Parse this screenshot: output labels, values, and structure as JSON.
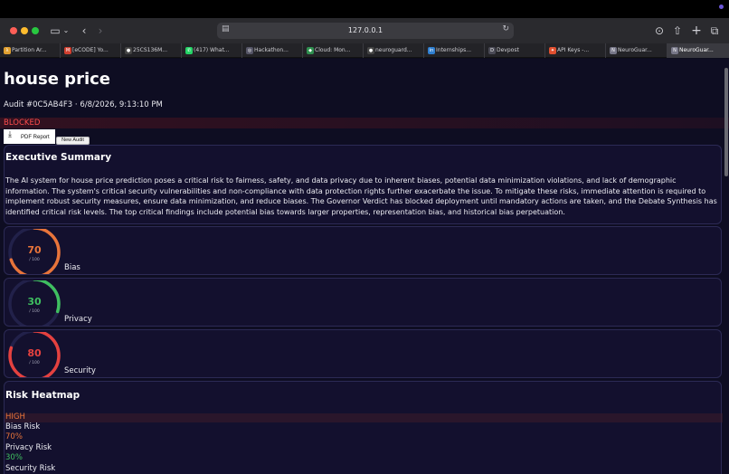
{
  "browser": {
    "url": "127.0.0.1",
    "tabs": [
      {
        "label": "Partition Ar...",
        "icon": "lambda-icon",
        "color": "#e0a030"
      },
      {
        "label": "[eCODE] Yo...",
        "icon": "gmail-icon",
        "color": "#d04030"
      },
      {
        "label": "25CS136M...",
        "icon": "github-icon",
        "color": "#444444"
      },
      {
        "label": "(417) What...",
        "icon": "whatsapp-icon",
        "color": "#25d366"
      },
      {
        "label": "Hackathon...",
        "icon": "devfolio-icon",
        "color": "#555566"
      },
      {
        "label": "Cloud: Mon...",
        "icon": "mongodb-icon",
        "color": "#2f8f4f"
      },
      {
        "label": "neuroguard...",
        "icon": "github-icon",
        "color": "#444444"
      },
      {
        "label": "Internships...",
        "icon": "internshala-icon",
        "color": "#2f7fd0"
      },
      {
        "label": "Devpost",
        "icon": "devpost-icon",
        "color": "#4a4a55"
      },
      {
        "label": "API Keys -...",
        "icon": "key-icon",
        "color": "#e05030"
      },
      {
        "label": "NeuroGuar...",
        "icon": "neuroguard-icon",
        "color": "#777788"
      },
      {
        "label": "NeuroGuar...",
        "icon": "neuroguard-icon",
        "color": "#777788"
      }
    ]
  },
  "page": {
    "title": "house price",
    "audit_meta": "Audit #0C5AB4F3 · 6/8/2026, 9:13:10 PM",
    "verdict": "BLOCKED",
    "verdict_color": "#ff4c4c",
    "pdf_button": "PDF Report",
    "new_audit_button": "New Audit"
  },
  "summary": {
    "heading": "Executive Summary",
    "text": "The AI system for house price prediction poses a critical risk to fairness, safety, and data privacy due to inherent biases, potential data minimization violations, and lack of demographic information. The system's critical security vulnerabilities and non-compliance with data protection rights further exacerbate the issue. To mitigate these risks, immediate attention is required to implement robust security measures, ensure data minimization, and reduce biases. The Governor Verdict has blocked deployment until mandatory actions are taken, and the Debate Synthesis has identified critical risk levels. The top critical findings include potential bias towards larger properties, representation bias, and historical bias perpetuation."
  },
  "scores": [
    {
      "label": "Bias",
      "value": 70,
      "max": "/ 100",
      "color": "#e8743a"
    },
    {
      "label": "Privacy",
      "value": 30,
      "max": "/ 100",
      "color": "#3fbf60"
    },
    {
      "label": "Security",
      "value": 80,
      "max": "/ 100",
      "color": "#e5413f"
    }
  ],
  "heatmap": {
    "heading": "Risk Heatmap",
    "overall_level": "HIGH",
    "overall_color": "#e8743a",
    "rows": [
      {
        "label": "Bias Risk",
        "value": "70%",
        "color": "#e8743a"
      },
      {
        "label": "Privacy Risk",
        "value": "30%",
        "color": "#3fbf60"
      },
      {
        "label": "Security Risk",
        "value": "",
        "color": "#e5413f"
      }
    ]
  }
}
